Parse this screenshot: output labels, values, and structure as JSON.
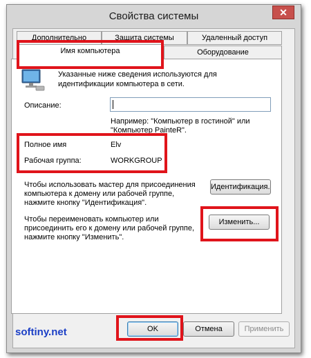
{
  "window": {
    "title": "Свойства системы",
    "close_icon": "close-icon"
  },
  "tabs": {
    "row_top": [
      "Дополнительно",
      "Защита системы",
      "Удаленный доступ"
    ],
    "row_bottom": [
      "Имя компьютера",
      "Оборудование"
    ],
    "active": "Имя компьютера"
  },
  "intro": {
    "line1": "Указанные ниже сведения используются для",
    "line2": "идентификации компьютера в сети.",
    "icon": "computer-icon"
  },
  "description": {
    "label": "Описание:",
    "value": "",
    "hint_line1": "Например: \"Компьютер в гостиной\" или",
    "hint_line2": "\"Компьютер PainteR\"."
  },
  "info": {
    "full_name_label": "Полное имя",
    "full_name_value": "Elv",
    "workgroup_label": "Рабочая группа:",
    "workgroup_value": "WORKGROUP"
  },
  "network_id": {
    "line1": "Чтобы использовать мастер для присоединения",
    "line2": "компьютера к домену или рабочей группе,",
    "line3": "нажмите кнопку \"Идентификация\".",
    "button": "Идентификация..."
  },
  "rename": {
    "line1": "Чтобы переименовать компьютер или",
    "line2": "присоединить его к домену или рабочей группе,",
    "line3": "нажмите кнопку \"Изменить\".",
    "button": "Изменить..."
  },
  "footer": {
    "ok": "OK",
    "cancel": "Отмена",
    "apply": "Применить"
  },
  "watermark": "softiny.net",
  "highlight_color": "#e0141b"
}
